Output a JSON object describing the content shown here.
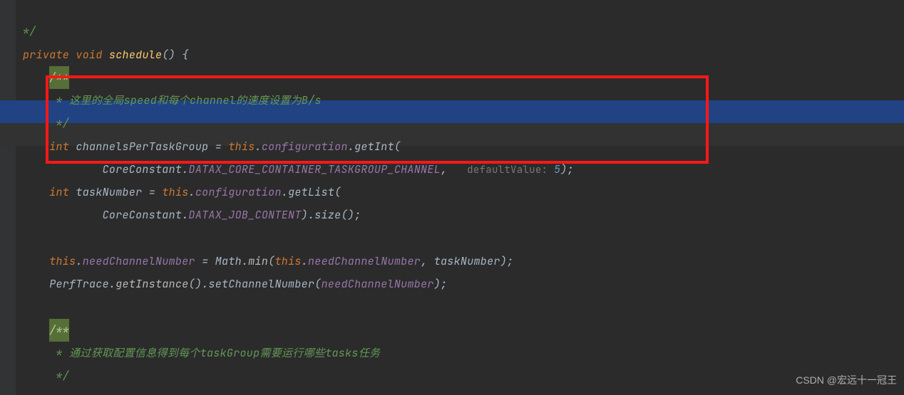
{
  "code": {
    "close_comment_top": "*/",
    "private": "private",
    "void": "void",
    "schedule": "schedule",
    "paren_open_brace": "() {",
    "doc_open": "/**",
    "comment1_star": " * ",
    "comment1_text": "这里的全局speed和每个channel的速度设置为B/s",
    "doc_close": " */",
    "int": "int",
    "channelsPerTaskGroup": "channelsPerTaskGroup",
    "equals": " = ",
    "this": "this",
    "dot": ".",
    "configuration": "configuration",
    "getInt": "getInt",
    "open_paren": "(",
    "CoreConstant": "CoreConstant",
    "const_channel": "DATAX_CORE_CONTAINER_TASKGROUP_CHANNEL",
    "comma_sp": ", ",
    "hint_defaultValue": "defaultValue: ",
    "default_val": "5",
    "close_call": ");",
    "taskNumber": "taskNumber",
    "getList": "getList",
    "const_jobcontent": "DATAX_JOB_CONTENT",
    "close_paren": ")",
    "size": "size",
    "empty_call": "();",
    "needChannelNumber": "needChannelNumber",
    "Math": "Math",
    "min": "min",
    "comma_task": ", taskNumber);",
    "PerfTrace": "PerfTrace",
    "getInstance": "getInstance",
    "openclose": "()",
    "setChannelNumber": "setChannelNumber",
    "close_call2": ");",
    "comment2_text": "通过获取配置信息得到每个taskGroup需要运行哪些tasks任务"
  },
  "watermark": "CSDN @宏远十一冠王"
}
